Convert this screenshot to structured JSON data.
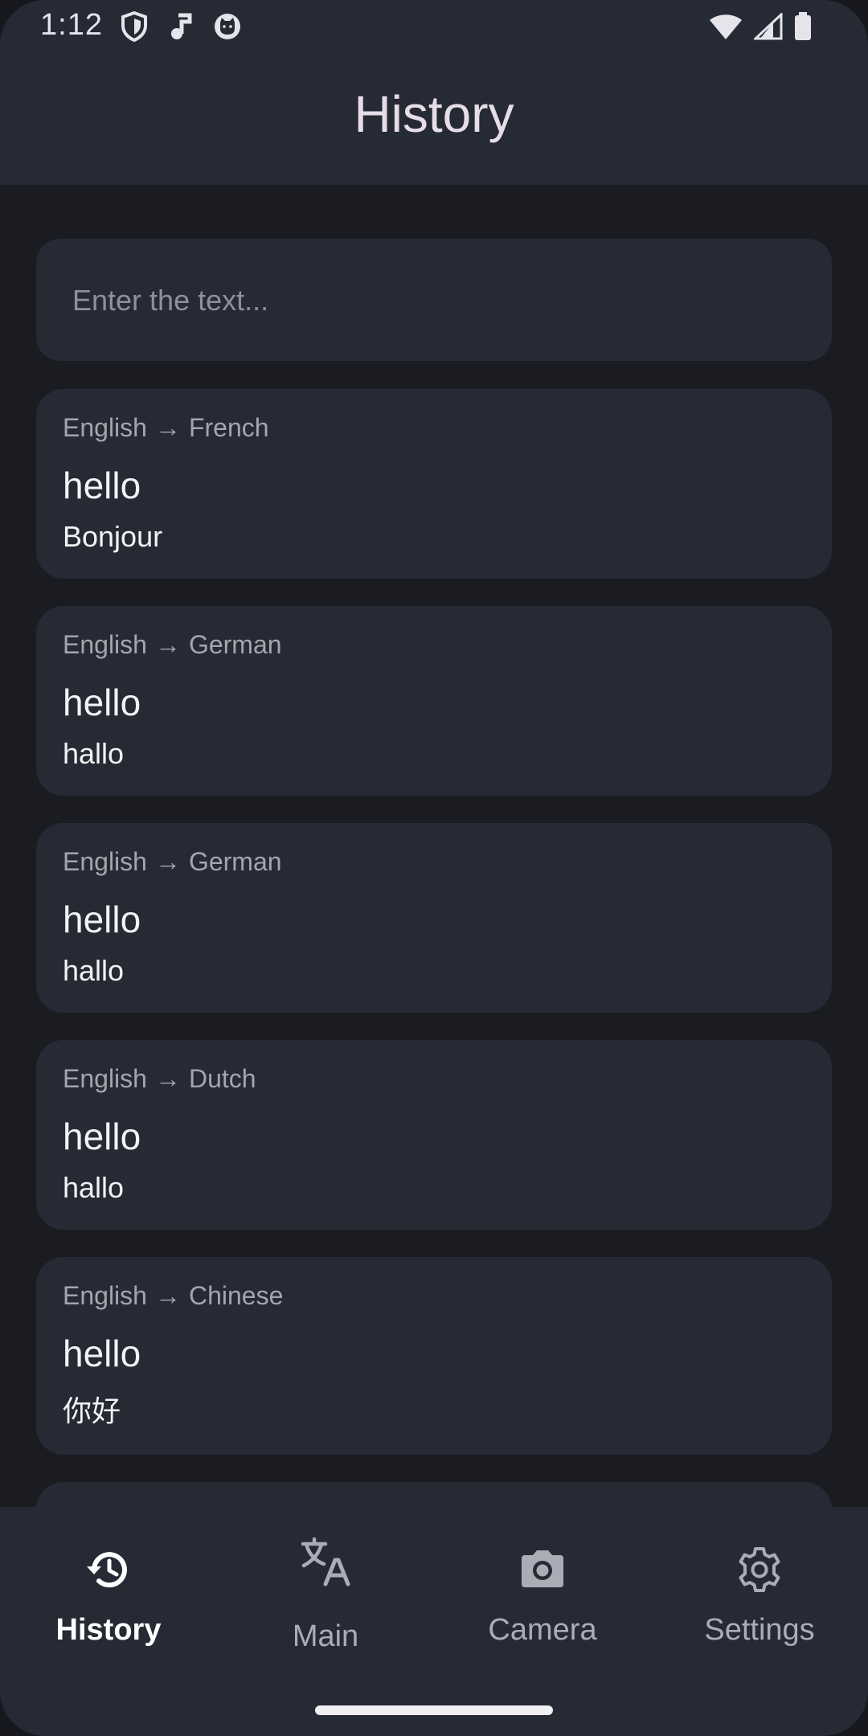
{
  "status_bar": {
    "time": "1:12",
    "left_icons": [
      "shield-icon",
      "music-note-icon",
      "cat-face-icon"
    ],
    "right_icons": [
      "wifi-icon",
      "cell-signal-icon",
      "battery-icon"
    ]
  },
  "header": {
    "title": "History"
  },
  "search": {
    "placeholder": "Enter the text...",
    "value": ""
  },
  "history": [
    {
      "from": "English",
      "to": "French",
      "source": "hello",
      "translation": "Bonjour"
    },
    {
      "from": "English",
      "to": "German",
      "source": "hello",
      "translation": "hallo"
    },
    {
      "from": "English",
      "to": "German",
      "source": "hello",
      "translation": "hallo"
    },
    {
      "from": "English",
      "to": "Dutch",
      "source": "hello",
      "translation": "hallo"
    },
    {
      "from": "English",
      "to": "Chinese",
      "source": "hello",
      "translation": "你好"
    }
  ],
  "arrow_symbol": "→",
  "bottom_nav": {
    "items": [
      {
        "label": "History",
        "icon": "history-icon",
        "active": true
      },
      {
        "label": "Main",
        "icon": "translate-icon",
        "active": false
      },
      {
        "label": "Camera",
        "icon": "camera-icon",
        "active": false
      },
      {
        "label": "Settings",
        "icon": "gear-icon",
        "active": false
      }
    ]
  },
  "colors": {
    "background": "#1a1c21",
    "surface": "#262a35",
    "bar": "#252a35",
    "text_primary": "#f2f2f5",
    "text_secondary": "#a2a6ad"
  }
}
